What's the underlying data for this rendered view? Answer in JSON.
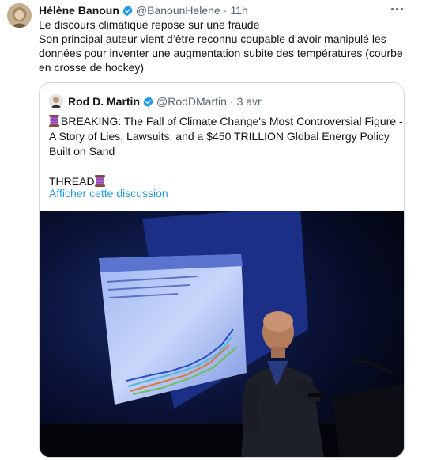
{
  "tweet": {
    "author_name": "Hélène Banoun",
    "handle": "@BanounHelene",
    "time": "11h",
    "lines": [
      "Le discours climatique repose sur une fraude",
      "Son principal auteur vient d’être reconnu coupable d’avoir manipulé les",
      "données pour inventer une augmentation subite des températures (courbe",
      "en crosse de hockey)"
    ]
  },
  "quote": {
    "author_name": "Rod D. Martin",
    "handle": "@RodDMartin",
    "time": "3 avr.",
    "lines": [
      "BREAKING: The Fall of Climate Change's Most Controversial Figure -",
      "A Story of Lies, Lawsuits, and a $450 TRILLION Global Energy Policy",
      "Built on Sand"
    ],
    "thread_label": "THREAD",
    "show_thread_link": "Afficher cette discussion"
  },
  "icons": {
    "verified": "verified-badge-icon",
    "more": "more-options-icon",
    "thread": "spool-of-thread-emoji"
  },
  "colors": {
    "accent": "#1d9bf0",
    "text": "#0f1419",
    "muted": "#536471",
    "border": "#cfd9de"
  }
}
